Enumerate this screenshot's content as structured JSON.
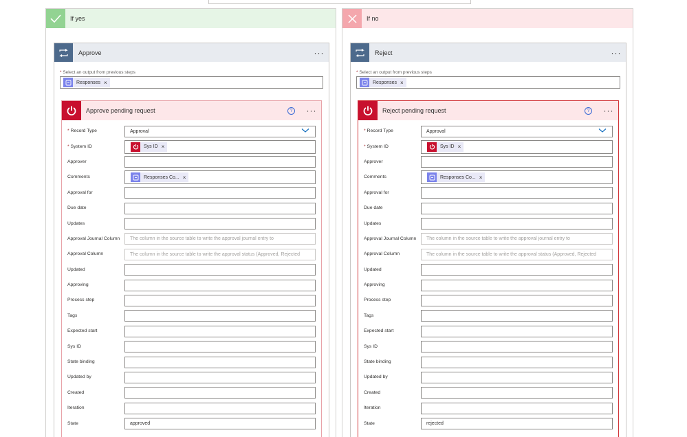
{
  "branches": {
    "yes": {
      "title": "If yes",
      "action": {
        "title": "Approve",
        "select_label": "Select an output from previous steps",
        "token": "Responses"
      },
      "servicenow": {
        "title": "Approve pending request",
        "fields": [
          {
            "label": "Record Type",
            "required": true,
            "value": "Approval",
            "kind": "dropdown"
          },
          {
            "label": "System ID",
            "required": true,
            "token": "Sys ID",
            "kind": "token-red"
          },
          {
            "label": "Approver",
            "value": ""
          },
          {
            "label": "Comments",
            "token": "Responses Co...",
            "kind": "token-blue"
          },
          {
            "label": "Approval for",
            "value": ""
          },
          {
            "label": "Due date",
            "value": ""
          },
          {
            "label": "Updates",
            "value": ""
          },
          {
            "label": "Approval Journal Column",
            "placeholder": "The column in the source table to write the approval journal entry to"
          },
          {
            "label": "Approval Column",
            "placeholder": "The column in the source table to write the approval status (Approved, Rejected"
          },
          {
            "label": "Updated",
            "value": ""
          },
          {
            "label": "Approving",
            "value": ""
          },
          {
            "label": "Process step",
            "value": ""
          },
          {
            "label": "Tags",
            "value": ""
          },
          {
            "label": "Expected start",
            "value": ""
          },
          {
            "label": "Sys ID",
            "value": ""
          },
          {
            "label": "State binding",
            "value": ""
          },
          {
            "label": "Updated by",
            "value": ""
          },
          {
            "label": "Created",
            "value": ""
          },
          {
            "label": "Iteration",
            "value": ""
          },
          {
            "label": "State",
            "value": "approved"
          }
        ]
      }
    },
    "no": {
      "title": "If no",
      "action": {
        "title": "Reject",
        "select_label": "Select an output from previous steps",
        "token": "Responses"
      },
      "servicenow": {
        "title": "Reject pending request",
        "fields": [
          {
            "label": "Record Type",
            "required": true,
            "value": "Approval",
            "kind": "dropdown"
          },
          {
            "label": "System ID",
            "required": true,
            "token": "Sys ID",
            "kind": "token-red"
          },
          {
            "label": "Approver",
            "value": ""
          },
          {
            "label": "Comments",
            "token": "Responses Co...",
            "kind": "token-blue"
          },
          {
            "label": "Approval for",
            "value": ""
          },
          {
            "label": "Due date",
            "value": ""
          },
          {
            "label": "Updates",
            "value": ""
          },
          {
            "label": "Approval Journal Column",
            "placeholder": "The column in the source table to write the approval journal entry to"
          },
          {
            "label": "Approval Column",
            "placeholder": "The column in the source table to write the approval status (Approved, Rejected"
          },
          {
            "label": "Updated",
            "value": ""
          },
          {
            "label": "Approving",
            "value": ""
          },
          {
            "label": "Process step",
            "value": ""
          },
          {
            "label": "Tags",
            "value": ""
          },
          {
            "label": "Expected start",
            "value": ""
          },
          {
            "label": "Sys ID",
            "value": ""
          },
          {
            "label": "State binding",
            "value": ""
          },
          {
            "label": "Updated by",
            "value": ""
          },
          {
            "label": "Created",
            "value": ""
          },
          {
            "label": "Iteration",
            "value": ""
          },
          {
            "label": "State",
            "value": "rejected"
          }
        ]
      }
    }
  },
  "colors": {
    "yes_accent": "#92d392",
    "no_accent": "#f4a7ad",
    "servicenow_red": "#c8102e",
    "forms_purple": "#7b83eb",
    "control_blue": "#4d6a8c"
  },
  "icons": {
    "yes": "check-icon",
    "no": "x-icon",
    "action": "apply-to-each-loop-icon",
    "servicenow": "power-icon",
    "token": "forms-icon"
  }
}
